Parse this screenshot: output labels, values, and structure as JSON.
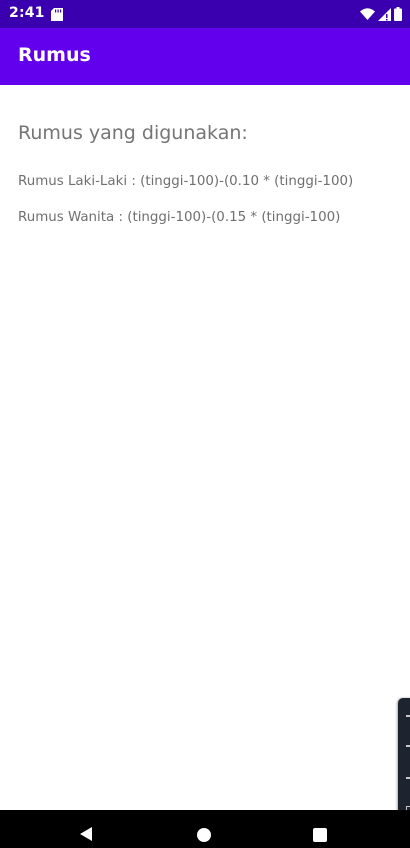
{
  "status_bar": {
    "time": "2:41",
    "icons": [
      "sd-card-icon",
      "wifi-icon",
      "signal-icon",
      "battery-icon"
    ]
  },
  "app_bar": {
    "title": "Rumus"
  },
  "content": {
    "heading": "Rumus yang digunakan:",
    "formula_male": "Rumus Laki-Laki : (tinggi-100)-(0.10 * (tinggi-100)",
    "formula_female": "Rumus Wanita : (tinggi-100)-(0.15 * (tinggi-100)"
  },
  "navigation_bar": {
    "buttons": [
      "back-icon",
      "home-icon",
      "recents-icon"
    ]
  },
  "colors": {
    "status_bar": "#3a00b0",
    "app_bar": "#6200ee",
    "text_secondary": "#757575",
    "background": "#ffffff"
  }
}
